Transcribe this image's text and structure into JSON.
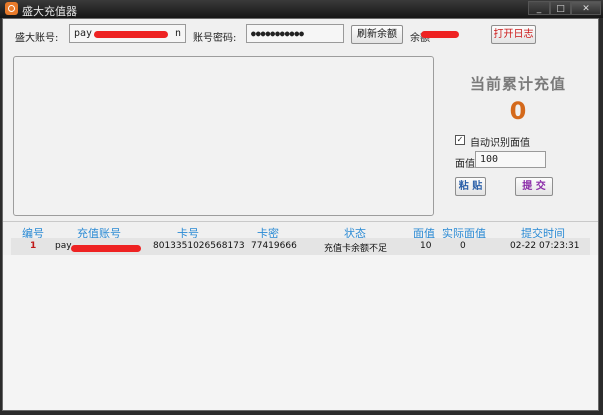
{
  "window": {
    "title": "盛大充值器",
    "controls": [
      "_",
      "□",
      "✕"
    ]
  },
  "account": {
    "label": "盛大账号:",
    "value_visible_start": "pay.",
    "value_visible_end": "n"
  },
  "password": {
    "label": "账号密码:",
    "value": "●●●●●●●●●●●"
  },
  "refresh_button": "刷新余额",
  "balance_label_visible": "余额",
  "open_log_button": "打开日志",
  "total": {
    "label": "当前累计充值",
    "value": "0"
  },
  "auto_detect": {
    "label": "自动识别面值",
    "checked": true,
    "check_mark": "✓"
  },
  "face_value": {
    "label": "面值",
    "value": "100"
  },
  "paste_button": "粘 贴",
  "submit_button": "提 交",
  "table": {
    "headers": [
      "编号",
      "充值账号",
      "卡号",
      "卡密",
      "状态",
      "面值",
      "实际面值",
      "提交时间"
    ],
    "rows": [
      {
        "index": "1",
        "account_visible": "pay",
        "card_number": "8013351026568173",
        "card_password": "77419666",
        "status": "充值卡余额不足",
        "face_value": "10",
        "actual_value": "0",
        "submit_time": "02-22 07:23:31"
      }
    ]
  },
  "colors": {
    "accent_blue": "#2a8ad4",
    "total_orange": "#d4691b",
    "log_button_red": "#cc1a1a",
    "submit_purple": "#8a2aa8",
    "redaction_red": "#ee2222"
  }
}
